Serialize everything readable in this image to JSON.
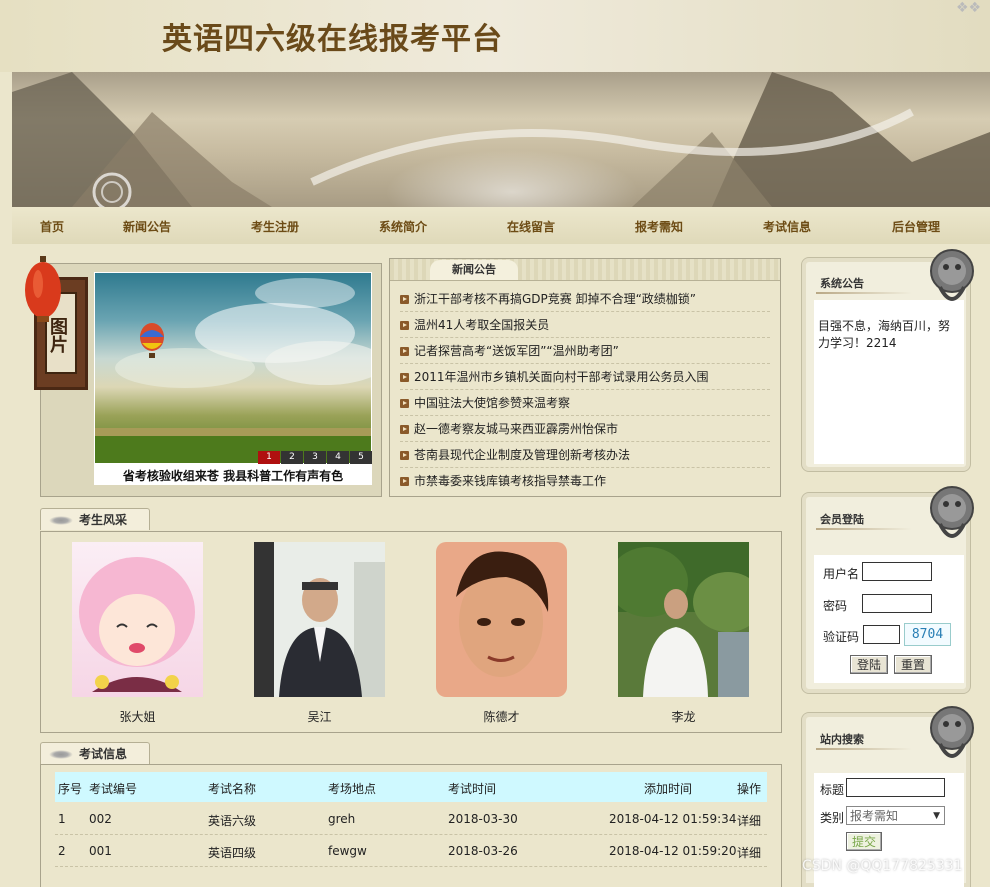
{
  "site": {
    "title": "英语四六级在线报考平台"
  },
  "nav": {
    "items": [
      "首页",
      "新闻公告",
      "考生注册",
      "系统简介",
      "在线留言",
      "报考需知",
      "考试信息",
      "后台管理"
    ]
  },
  "picture": {
    "label": "图片",
    "caption": "省考核验收组来苍 我县科普工作有声有色",
    "slides": [
      "1",
      "2",
      "3",
      "4",
      "5"
    ]
  },
  "news": {
    "heading": "新闻公告",
    "items": [
      "浙江干部考核不再搞GDP竞赛 卸掉不合理“政绩枷锁”",
      "温州41人考取全国报关员",
      "记者探营高考“送饭军团”“温州助考团”",
      "2011年温州市乡镇机关面向村干部考试录用公务员入围",
      "中国驻法大使馆参赞来温考察",
      "赵一德考察友城马来西亚霹雳州怡保市",
      "苍南县现代企业制度及管理创新考核办法",
      "市禁毒委来钱库镇考核指导禁毒工作"
    ]
  },
  "students": {
    "heading": "考生风采",
    "items": [
      {
        "name": "张大姐"
      },
      {
        "name": "吴江"
      },
      {
        "name": "陈德才"
      },
      {
        "name": "李龙"
      }
    ]
  },
  "exams": {
    "heading": "考试信息",
    "columns": [
      "序号",
      "考试编号",
      "考试名称",
      "考场地点",
      "考试时间",
      "添加时间",
      "操作"
    ],
    "rows": [
      [
        "1",
        "002",
        "英语六级",
        "greh",
        "2018-03-30",
        "2018-04-12 01:59:34",
        "详细"
      ],
      [
        "2",
        "001",
        "英语四级",
        "fewgw",
        "2018-03-26",
        "2018-04-12 01:59:20",
        "详细"
      ]
    ]
  },
  "sidebar": {
    "notice": {
      "title": "系统公告",
      "text": "目强不息，海纳百川，努力学习！2214"
    },
    "login": {
      "title": "会员登陆",
      "username_label": "用户名",
      "password_label": "密码",
      "captcha_label": "验证码",
      "captcha_code": "8704",
      "login_button": "登陆",
      "reset_button": "重置"
    },
    "search": {
      "title": "站内搜索",
      "title_label": "标题",
      "category_label": "类别",
      "category_selected": "报考需知",
      "submit_button": "提交"
    }
  },
  "watermark": "CSDN @QQ177825331",
  "colors": {
    "page_bg": "#ebe6cc",
    "nav_text": "#6d4c15",
    "table_head_bg": "#cff9ff",
    "title_color": "#6a4a1a"
  }
}
